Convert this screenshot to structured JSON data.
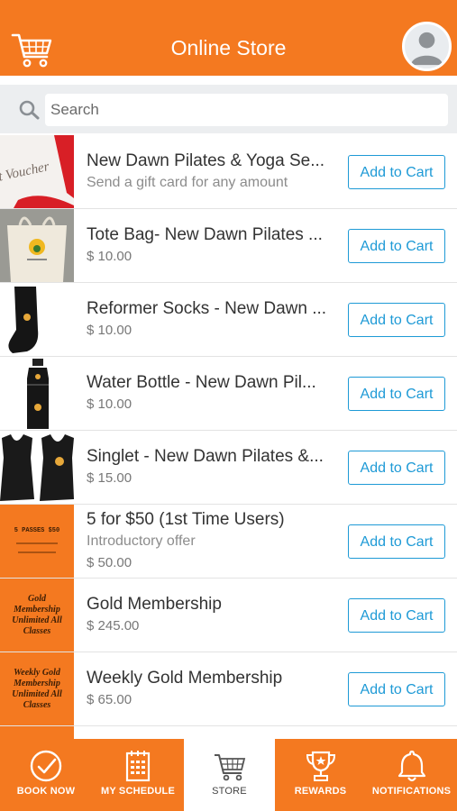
{
  "header": {
    "title": "Online Store",
    "icon_left": "shopping-cart-icon",
    "icon_right": "user-avatar-icon"
  },
  "search": {
    "placeholder": "Search",
    "icon": "magnifier-icon"
  },
  "colors": {
    "brand_orange": "#f47920",
    "button_blue": "#1e9ad6"
  },
  "products": [
    {
      "name": "New Dawn Pilates & Yoga Se...",
      "subtitle": "Send a gift card for any amount",
      "price": "",
      "button": "Add to Cart",
      "thumb_text": "t Voucher"
    },
    {
      "name": "Tote Bag- New Dawn Pilates ...",
      "subtitle": "",
      "price": "$ 10.00",
      "button": "Add to Cart",
      "thumb_text": ""
    },
    {
      "name": "Reformer Socks - New Dawn ...",
      "subtitle": "",
      "price": "$ 10.00",
      "button": "Add to Cart",
      "thumb_text": ""
    },
    {
      "name": "Water Bottle - New Dawn Pil...",
      "subtitle": "",
      "price": "$ 10.00",
      "button": "Add to Cart",
      "thumb_text": ""
    },
    {
      "name": "Singlet - New Dawn Pilates &...",
      "subtitle": "",
      "price": "$ 15.00",
      "button": "Add to Cart",
      "thumb_text": ""
    },
    {
      "name": "5 for $50 (1st Time Users)",
      "subtitle": "Introductory offer",
      "price": "$ 50.00",
      "button": "Add to Cart",
      "thumb_text": "5 PASSES $50"
    },
    {
      "name": "Gold Membership",
      "subtitle": "",
      "price": "$ 245.00",
      "button": "Add to Cart",
      "thumb_text": "Gold Membership Unlimited All Classes"
    },
    {
      "name": "Weekly Gold Membership",
      "subtitle": "",
      "price": "$ 65.00",
      "button": "Add to Cart",
      "thumb_text": "Weekly Gold Membership Unlimited All Classes"
    }
  ],
  "tabs": [
    {
      "label": "BOOK NOW",
      "icon": "check-circle-icon",
      "active": false
    },
    {
      "label": "MY SCHEDULE",
      "icon": "calendar-icon",
      "active": false
    },
    {
      "label": "STORE",
      "icon": "shopping-cart-icon",
      "active": true
    },
    {
      "label": "REWARDS",
      "icon": "trophy-icon",
      "active": false
    },
    {
      "label": "NOTIFICATIONS",
      "icon": "bell-icon",
      "active": false
    }
  ]
}
